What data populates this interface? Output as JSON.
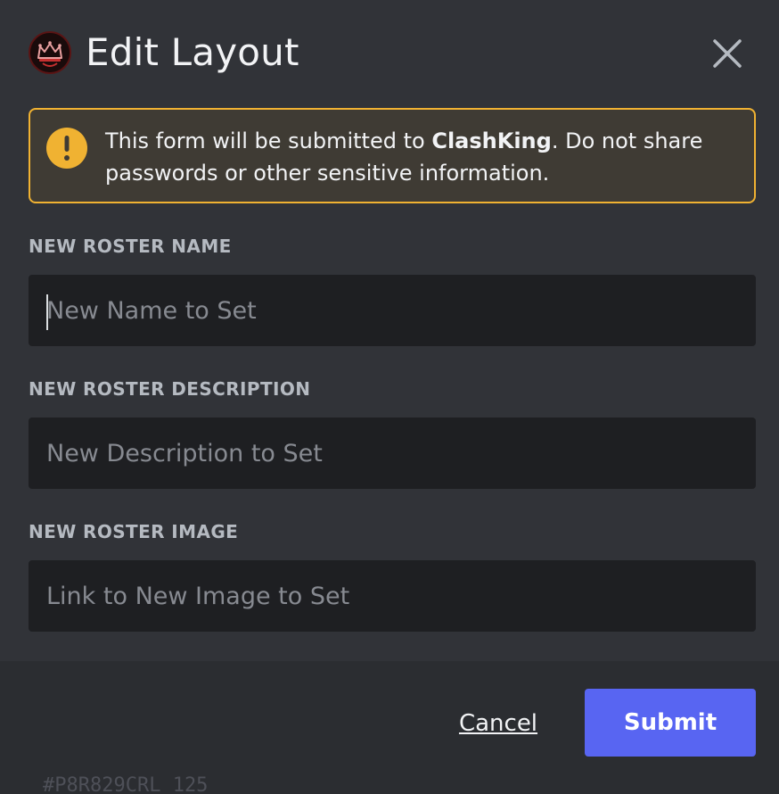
{
  "header": {
    "title": "Edit Layout",
    "avatar_icon": "crown-logo-icon",
    "close_icon": "close-icon"
  },
  "warning": {
    "icon": "exclamation-icon",
    "text_before": "This form will be submitted to ",
    "app_name": "ClashKing",
    "text_after": ". Do not share passwords or other sensitive information."
  },
  "fields": [
    {
      "label": "NEW ROSTER NAME",
      "placeholder": "New Name to Set",
      "value": ""
    },
    {
      "label": "NEW ROSTER DESCRIPTION",
      "placeholder": "New Description to Set",
      "value": ""
    },
    {
      "label": "NEW ROSTER IMAGE",
      "placeholder": "Link to New Image to Set",
      "value": ""
    }
  ],
  "footer": {
    "cancel_label": "Cancel",
    "submit_label": "Submit"
  },
  "background_fragment": "#P8R829CRL 125",
  "colors": {
    "modal_bg": "#313338",
    "footer_bg": "#2b2d31",
    "input_bg": "#1e1f22",
    "warning_border": "#f0b232",
    "warning_bg": "#3f3b34",
    "accent": "#5865f2",
    "label": "#b5bac1"
  }
}
